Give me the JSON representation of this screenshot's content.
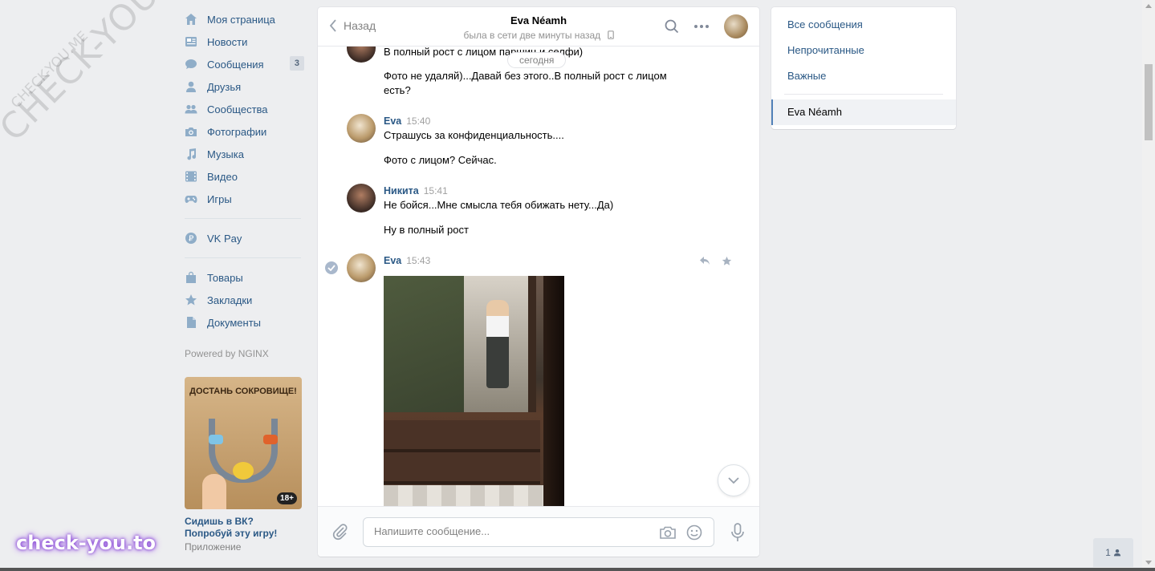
{
  "watermark": {
    "big": "CHECK-YOU.ME",
    "small": "CHECK-YOU.ME",
    "bottom": "check-you.to"
  },
  "nav": {
    "items": [
      {
        "label": "Моя страница",
        "icon": "home-icon"
      },
      {
        "label": "Новости",
        "icon": "news-icon"
      },
      {
        "label": "Сообщения",
        "icon": "messages-icon",
        "count": "3"
      },
      {
        "label": "Друзья",
        "icon": "friends-icon"
      },
      {
        "label": "Сообщества",
        "icon": "communities-icon"
      },
      {
        "label": "Фотографии",
        "icon": "camera-icon"
      },
      {
        "label": "Музыка",
        "icon": "music-icon"
      },
      {
        "label": "Видео",
        "icon": "video-icon"
      },
      {
        "label": "Игры",
        "icon": "gamepad-icon"
      }
    ],
    "pay": {
      "label": "VK Pay",
      "icon": "vkpay-icon"
    },
    "extra": [
      {
        "label": "Товары",
        "icon": "bag-icon"
      },
      {
        "label": "Закладки",
        "icon": "star-icon"
      },
      {
        "label": "Документы",
        "icon": "document-icon"
      }
    ],
    "powered": "Powered by NGINX"
  },
  "ad": {
    "image_title": "ДОСТАНЬ СОКРОВИЩЕ!",
    "age_badge": "18+",
    "text": "Сидишь в ВК? Попробуй эту игру!",
    "sub": "Приложение"
  },
  "chat": {
    "back_label": "Назад",
    "peer_name": "Eva Néamh",
    "peer_status": "была в сети две минуты назад",
    "date_pill": "сегодня",
    "messages": {
      "m0_line1": "В полный рост с лицом паршиц и селфи)",
      "m0_line2": "Фото не удаляй)...Давай без этого..В полный рост с лицом есть?",
      "eva1_author": "Eva",
      "eva1_time": "15:40",
      "eva1_line1": "Страшусь за конфиденциальность....",
      "eva1_line2": "Фото с лицом? Сейчас.",
      "nik_author": "Никита",
      "nik_time": "15:41",
      "nik_line1": "Не бойся...Мне смысла тебя обижать нету...Да)",
      "nik_line2": "Ну в полный рост",
      "eva2_author": "Eva",
      "eva2_time": "15:43"
    },
    "composer_placeholder": "Напишите сообщение..."
  },
  "filter": {
    "items": [
      "Все сообщения",
      "Непрочитанные",
      "Важные"
    ],
    "selected": "Eva Néamh"
  },
  "friends_online": "1",
  "colors": {
    "link": "#2a5885",
    "accent": "#5181b8",
    "bg": "#edeef0"
  }
}
